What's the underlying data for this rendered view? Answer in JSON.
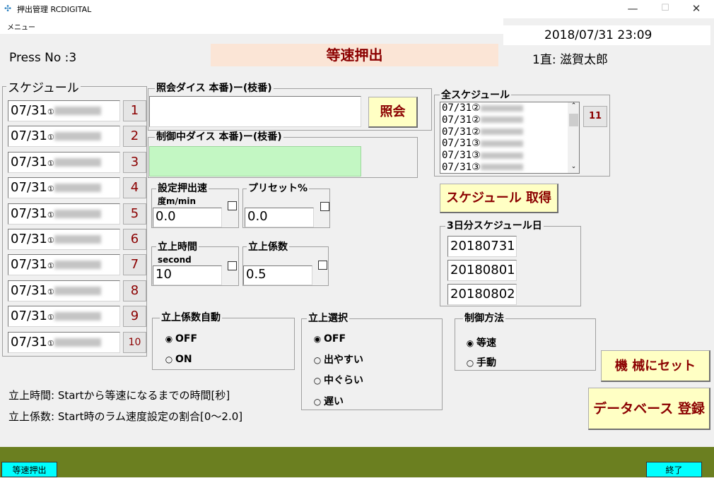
{
  "window": {
    "title": "押出管理 RCDIGITAL",
    "min": "—",
    "max": "☐",
    "close": "✕"
  },
  "menu": {
    "label": "メニュー"
  },
  "datetime": "2018/07/31  23:09",
  "press_no": "Press No :3",
  "page_title": "等速押出",
  "operator": "1直:  滋賀太郎",
  "schedule": {
    "label": "スケジュール",
    "items": [
      {
        "date": "07/31",
        "mark": "①",
        "num": "1"
      },
      {
        "date": "07/31",
        "mark": "①",
        "num": "2"
      },
      {
        "date": "07/31",
        "mark": "①",
        "num": "3"
      },
      {
        "date": "07/31",
        "mark": "①",
        "num": "4"
      },
      {
        "date": "07/31",
        "mark": "①",
        "num": "5"
      },
      {
        "date": "07/31",
        "mark": "①",
        "num": "6"
      },
      {
        "date": "07/31",
        "mark": "①",
        "num": "7"
      },
      {
        "date": "07/31",
        "mark": "①",
        "num": "8"
      },
      {
        "date": "07/31",
        "mark": "①",
        "num": "9"
      },
      {
        "date": "07/31",
        "mark": "①",
        "num": "10"
      }
    ]
  },
  "query": {
    "label": "照会ダイス 本番)ー(枝番)",
    "value": "",
    "button": "照会"
  },
  "control": {
    "label": "制御中ダイス 本番)ー(枝番)",
    "value": ""
  },
  "speed": {
    "label1": "設定押出速",
    "label2": "度m/min",
    "value": "0.0"
  },
  "preset": {
    "label": "プリセット%",
    "value": "0.0"
  },
  "rise_time": {
    "label": "立上時間",
    "unit": "second",
    "value": "10"
  },
  "rise_coef": {
    "label": "立上係数",
    "value": "0.5"
  },
  "all_schedule": {
    "label": "全スケジュール",
    "items": [
      {
        "date": "07/31",
        "mark": "②"
      },
      {
        "date": "07/31",
        "mark": "②"
      },
      {
        "date": "07/31",
        "mark": "②"
      },
      {
        "date": "07/31",
        "mark": "③"
      },
      {
        "date": "07/31",
        "mark": "③"
      },
      {
        "date": "07/31",
        "mark": "③"
      }
    ],
    "count": "11"
  },
  "get_schedule": "スケジュール 取得",
  "three_day": {
    "label": "3日分スケジュール日",
    "dates": [
      "20180731",
      "20180801",
      "20180802"
    ]
  },
  "auto_coef": {
    "label": "立上係数自動",
    "options": [
      "OFF",
      "ON"
    ]
  },
  "rise_select": {
    "label": "立上選択",
    "options": [
      "OFF",
      "出やすい",
      "中ぐらい",
      "遅い"
    ]
  },
  "ctrl_method": {
    "label": "制御方法",
    "options": [
      "等速",
      "手動"
    ]
  },
  "set_machine": "機 械にセット",
  "db_register": "データベース 登録",
  "notes": {
    "line1": "立上時間: Startから等速になるまでの時間[秒]",
    "line2": "立上係数: Start時のラム速度設定の割合[0～2.0]"
  },
  "footer": {
    "left": "等速押出",
    "right": "終了"
  },
  "colors": {
    "footer_bar": "#6b7f20",
    "title_bg": "#fbe5d6",
    "control_bg": "#c3f7c3",
    "accent_red": "#8b0000",
    "footer_btn": "#00ffff"
  }
}
